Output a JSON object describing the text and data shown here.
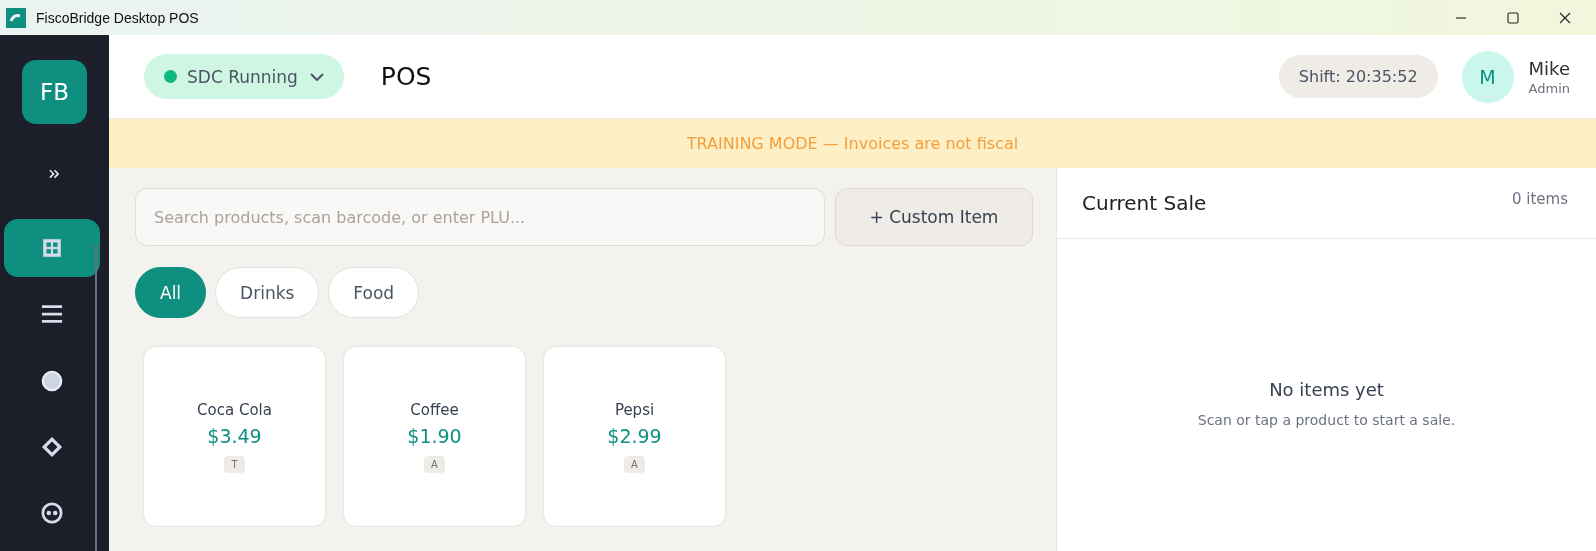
{
  "window": {
    "title": "FiscoBridge Desktop POS"
  },
  "sidebar": {
    "logo": "FB",
    "items": [
      {
        "kind": "grid",
        "selected": true
      },
      {
        "kind": "list",
        "selected": false
      },
      {
        "kind": "circle",
        "selected": false
      },
      {
        "kind": "diamond",
        "selected": false
      },
      {
        "kind": "face",
        "selected": false
      }
    ]
  },
  "header": {
    "status": {
      "label": "SDC Running",
      "color": "#10b981"
    },
    "title": "POS",
    "shift": "Shift: 20:35:52",
    "user": {
      "initial": "M",
      "name": "Mike",
      "role": "Admin"
    }
  },
  "banner": "TRAINING MODE — Invoices are not fiscal",
  "search": {
    "placeholder": "Search products, scan barcode, or enter PLU..."
  },
  "custom_button": "+ Custom Item",
  "categories": [
    {
      "label": "All",
      "selected": true
    },
    {
      "label": "Drinks",
      "selected": false
    },
    {
      "label": "Food",
      "selected": false
    }
  ],
  "products": [
    {
      "name": "Coca Cola",
      "price": "$3.49",
      "tax": "T"
    },
    {
      "name": "Coffee",
      "price": "$1.90",
      "tax": "A"
    },
    {
      "name": "Pepsi",
      "price": "$2.99",
      "tax": "A"
    }
  ],
  "sale": {
    "title": "Current Sale",
    "count": "0 items",
    "empty_title": "No items yet",
    "empty_text": "Scan or tap a product to start a sale."
  }
}
